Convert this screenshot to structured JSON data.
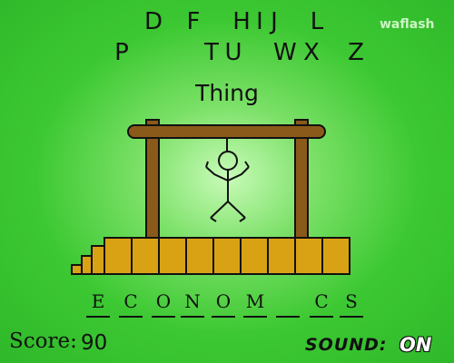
{
  "logo": "waflash",
  "available_letters": {
    "row1": [
      "D",
      "F",
      "H",
      "I",
      "J",
      "L"
    ],
    "row2": [
      "P",
      "T",
      "U",
      "W",
      "X",
      "Z"
    ]
  },
  "category": "Thing",
  "word_slots": [
    "E",
    "C",
    "O",
    "N",
    "O",
    "M",
    "",
    "C",
    "S"
  ],
  "score": {
    "label": "Score:",
    "value": "90"
  },
  "sound": {
    "label": "SOUND:",
    "value": "ON"
  },
  "colors": {
    "background": "#3cc832",
    "wood": "#8a5a1a",
    "platform": "#d9a215",
    "outline": "#111111",
    "sound_on": "#ffffff"
  }
}
